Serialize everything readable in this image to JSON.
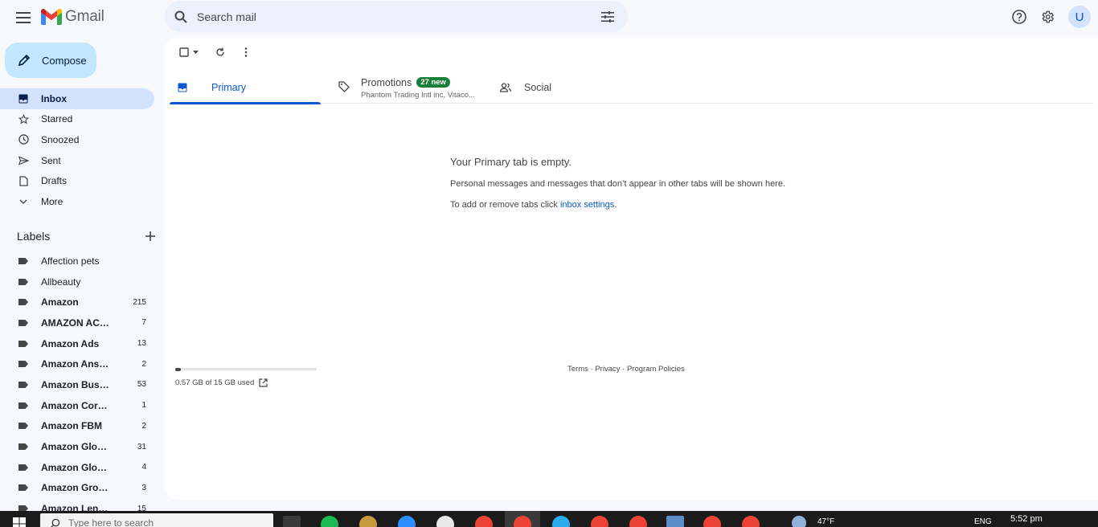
{
  "header": {
    "logo_text": "Gmail",
    "search_placeholder": "Search mail",
    "avatar_letter": "U"
  },
  "sidebar": {
    "compose_label": "Compose",
    "nav": [
      {
        "label": "Inbox",
        "icon": "inbox-icon",
        "active": true
      },
      {
        "label": "Starred",
        "icon": "star-icon"
      },
      {
        "label": "Snoozed",
        "icon": "clock-icon"
      },
      {
        "label": "Sent",
        "icon": "send-icon"
      },
      {
        "label": "Drafts",
        "icon": "draft-icon"
      },
      {
        "label": "More",
        "icon": "chevron-down-icon"
      }
    ],
    "labels_title": "Labels",
    "labels": [
      {
        "name": "Affection pets",
        "count": "",
        "bold": false
      },
      {
        "name": "Allbeauty",
        "count": "",
        "bold": false
      },
      {
        "name": "Amazon",
        "count": "215",
        "bold": true
      },
      {
        "name": "AMAZON ACCELER...",
        "count": "7",
        "bold": true
      },
      {
        "name": "Amazon Ads",
        "count": "13",
        "bold": true
      },
      {
        "name": "Amazon Answers",
        "count": "2",
        "bold": true
      },
      {
        "name": "Amazon Business",
        "count": "53",
        "bold": true
      },
      {
        "name": "Amazon Corporate",
        "count": "1",
        "bold": true
      },
      {
        "name": "Amazon FBM",
        "count": "2",
        "bold": true
      },
      {
        "name": "Amazon Global Lo...",
        "count": "31",
        "bold": true
      },
      {
        "name": "Amazon Global Sell...",
        "count": "4",
        "bold": true
      },
      {
        "name": "Amazon Growth",
        "count": "3",
        "bold": true
      },
      {
        "name": "Amazon Lending",
        "count": "15",
        "bold": true
      }
    ]
  },
  "tabs": {
    "primary": "Primary",
    "promotions": "Promotions",
    "promotions_badge": "27 new",
    "promotions_sub": "Phantom Trading Intl inc, Vitaco...",
    "social": "Social"
  },
  "empty_state": {
    "title": "Your Primary tab is empty.",
    "line1": "Personal messages and messages that don’t appear in other tabs will be shown here.",
    "line2_prefix": "To add or remove tabs click ",
    "line2_link": "inbox settings",
    "line2_suffix": "."
  },
  "storage": {
    "text": "0.57 GB of 15 GB used",
    "used_fraction": 0.038
  },
  "footer": {
    "terms": "Terms",
    "sep1": " · ",
    "privacy": "Privacy",
    "sep2": " · ",
    "policies": "Program Policies"
  },
  "taskbar": {
    "search_placeholder": "Type here to search",
    "weather": "47°F",
    "lang": "ENG",
    "time": "5:52 pm"
  },
  "colors": {
    "accent": "#0b57d0",
    "compose_bg": "#c2e7ff",
    "active_nav_bg": "#d3e3fd",
    "promo_badge": "#188038"
  }
}
